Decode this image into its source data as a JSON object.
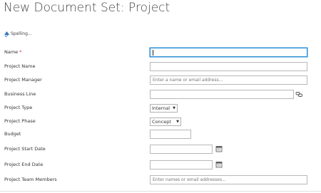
{
  "page": {
    "title": "New Document Set: Project"
  },
  "toolbar": {
    "spelling_label": "Spelling..."
  },
  "form": {
    "name": {
      "label": "Name",
      "required_marker": "*",
      "value": ""
    },
    "project_name": {
      "label": "Project Name",
      "value": ""
    },
    "project_manager": {
      "label": "Project Manager",
      "placeholder": "Enter a name or email address..."
    },
    "business_line": {
      "label": "Business Line",
      "value": "",
      "icon": "link-icon"
    },
    "project_type": {
      "label": "Project Type",
      "selected": "Internal"
    },
    "project_phase": {
      "label": "Project Phase",
      "selected": "Concept"
    },
    "budget": {
      "label": "Budget",
      "value": ""
    },
    "project_start_date": {
      "label": "Project Start Date",
      "value": "",
      "icon": "calendar-icon"
    },
    "project_end_date": {
      "label": "Project End Date",
      "value": "",
      "icon": "calendar-icon"
    },
    "project_team_members": {
      "label": "Project Team Members",
      "placeholder": "Enter names or email addresses..."
    }
  },
  "colors": {
    "focus_border": "#2a8dd4",
    "required": "#c5221f"
  }
}
